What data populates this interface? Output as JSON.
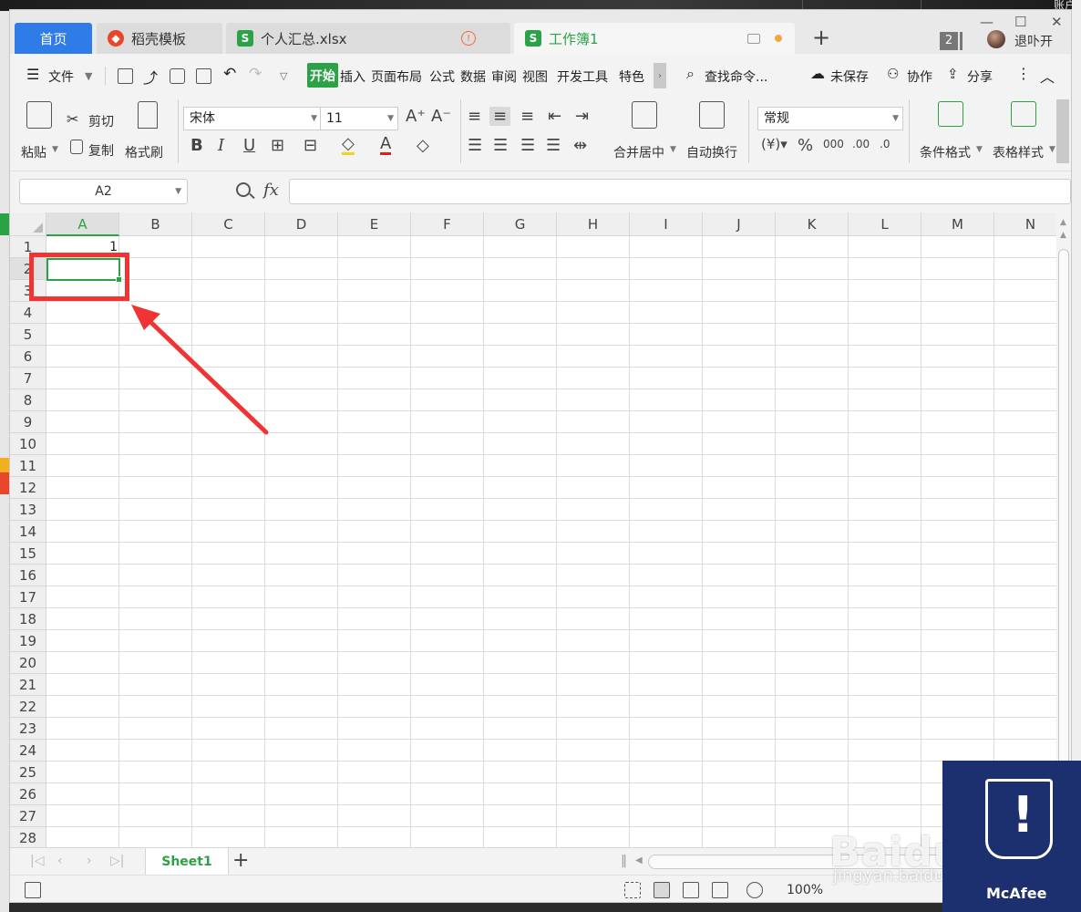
{
  "window": {
    "tabs": [
      {
        "label": "首页"
      },
      {
        "label": "稻壳模板"
      },
      {
        "label": "个人汇总.xlsx"
      },
      {
        "label": "工作簿1"
      }
    ],
    "tab_count": "2",
    "username": "退卟开",
    "desktop_account": "账户"
  },
  "menu": {
    "file": "文件",
    "items": [
      "开始",
      "插入",
      "页面布局",
      "公式",
      "数据",
      "审阅",
      "视图",
      "开发工具",
      "特色"
    ],
    "search": "查找命令...",
    "unsaved": "未保存",
    "collab": "协作",
    "share": "分享"
  },
  "ribbon": {
    "paste": "粘贴",
    "cut": "剪切",
    "copy": "复制",
    "format_painter": "格式刷",
    "font_name": "宋体",
    "font_size": "11",
    "bold": "B",
    "italic": "I",
    "underline": "U",
    "font_color": "A",
    "merge_center": "合并居中",
    "wrap_text": "自动换行",
    "number_format": "常规",
    "conditional_format": "条件格式",
    "table_style": "表格样式",
    "percent": "%",
    "thousands": "000",
    "inc_decimal": ".00",
    "dec_decimal": ".0"
  },
  "formula": {
    "name_box": "A2",
    "fx": "fx",
    "content": ""
  },
  "grid": {
    "columns": [
      "A",
      "B",
      "C",
      "D",
      "E",
      "F",
      "G",
      "H",
      "I",
      "J",
      "K",
      "L",
      "M",
      "N"
    ],
    "rows": [
      "1",
      "2",
      "3",
      "4",
      "5",
      "6",
      "7",
      "8",
      "9",
      "10",
      "11",
      "12",
      "13",
      "14",
      "15",
      "16",
      "17",
      "18",
      "19",
      "20",
      "21",
      "22",
      "23",
      "24",
      "25",
      "26",
      "27",
      "28"
    ],
    "cells": {
      "A1": "1"
    },
    "selected_cell": "A2"
  },
  "sheets": {
    "tabs": [
      "Sheet1"
    ],
    "add": "+"
  },
  "status": {
    "zoom": "100%"
  },
  "watermark": {
    "baidu": "Baidu经验",
    "baidu_url": "jingyan.baidu.com",
    "mcafee": "McAfee"
  },
  "colors": {
    "accent": "#2ba246",
    "home_tab": "#2f7be8",
    "annotation": "#f03434"
  }
}
